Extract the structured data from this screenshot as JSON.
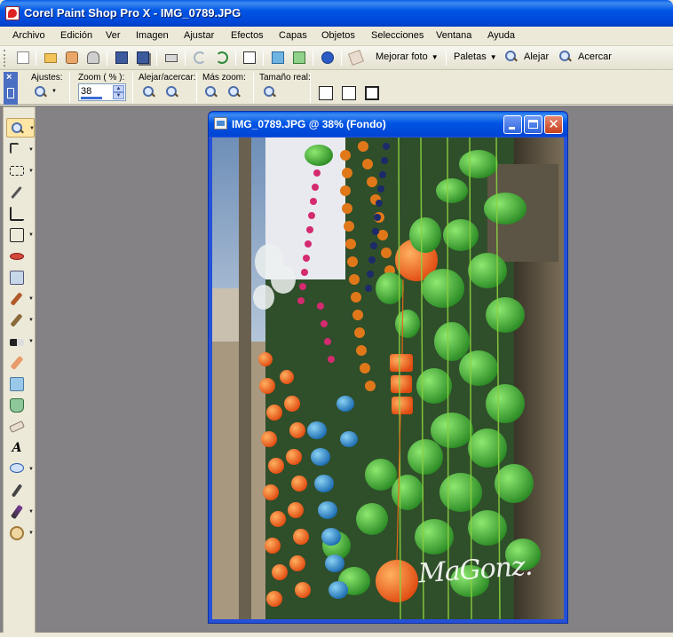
{
  "window": {
    "title": "Corel Paint Shop Pro X - IMG_0789.JPG"
  },
  "menu": [
    "Archivo",
    "Edición",
    "Ver",
    "Imagen",
    "Ajustar",
    "Efectos",
    "Capas",
    "Objetos",
    "Selecciones",
    "Ventana",
    "Ayuda"
  ],
  "toolbar": {
    "icons": [
      "new-file-icon",
      "open-folder-icon",
      "browse-icon",
      "scan-icon",
      "save-icon",
      "save-as-icon",
      "print-icon",
      "undo-icon",
      "redo-icon",
      "crop-icon",
      "resize-icon",
      "batch-icon",
      "info-icon",
      "eraser-icon"
    ],
    "enhance_label": "Mejorar foto",
    "palettes_label": "Paletas",
    "zoom_out_label": "Alejar",
    "zoom_in_label": "Acercar"
  },
  "tool_options": {
    "presets_label": "Ajustes:",
    "zoom_label": "Zoom ( % ):",
    "zoom_value": "38",
    "zoom_out_in_label": "Alejar/acercar:",
    "more_zoom_label": "Más zoom:",
    "actual_size_label": "Tamaño real:"
  },
  "tools": [
    "zoom-tool",
    "pick-tool",
    "selection-tool",
    "dropper-tool",
    "crop-tool",
    "straighten-tool",
    "red-eye-tool",
    "clone-tool",
    "paint-brush-tool",
    "airbrush-tool",
    "lighten-darken-tool",
    "dodge-tool",
    "scratch-remover-tool",
    "blend-tool",
    "eraser-tool",
    "text-tool",
    "preset-shape-tool",
    "pen-tool",
    "color-replacer-tool",
    "warp-tool"
  ],
  "document": {
    "title": "IMG_0789.JPG @  38% (Fondo)",
    "watermark": "MaGonz."
  },
  "colors": {
    "title_blue": "#0055e5",
    "workspace": "#848284",
    "chrome": "#ece9d8"
  }
}
